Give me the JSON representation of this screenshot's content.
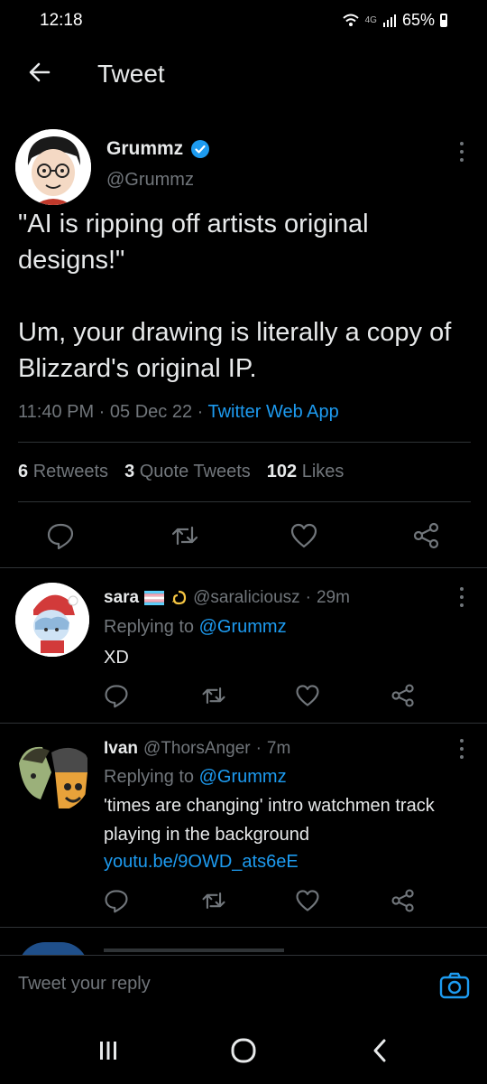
{
  "status_bar": {
    "time": "12:18",
    "network": "4G",
    "battery": "65%"
  },
  "header": {
    "title": "Tweet"
  },
  "tweet": {
    "author_name": "Grummz",
    "author_handle": "@Grummz",
    "text": "\"AI is ripping off artists original designs!\"\n\nUm, your drawing is literally a copy of Blizzard's original IP.",
    "time": "11:40 PM",
    "date": "05 Dec 22",
    "source": "Twitter Web App",
    "retweets_count": "6",
    "retweets_label": "Retweets",
    "quotes_count": "3",
    "quotes_label": "Quote Tweets",
    "likes_count": "102",
    "likes_label": "Likes"
  },
  "replies": [
    {
      "name": "sara",
      "handle": "@saraliciousz",
      "age": "29m",
      "replying_prefix": "Replying to",
      "replying_to": "@Grummz",
      "text": "XD"
    },
    {
      "name": "Ivan",
      "handle": "@ThorsAnger",
      "age": "7m",
      "replying_prefix": "Replying to",
      "replying_to": "@Grummz",
      "text": "'times are changing' intro watchmen track playing in the background",
      "link": "youtu.be/9OWD_ats6eE"
    }
  ],
  "compose": {
    "placeholder": "Tweet your reply"
  },
  "colors": {
    "background": "#000000",
    "accent": "#1d9bf0",
    "muted": "#71767b",
    "text": "#e7e9ea"
  },
  "icons": [
    "back-arrow-icon",
    "verified-badge-icon",
    "more-icon",
    "reply-icon",
    "retweet-icon",
    "like-icon",
    "share-icon",
    "camera-icon",
    "recents-icon",
    "home-icon",
    "back-nav-icon"
  ]
}
